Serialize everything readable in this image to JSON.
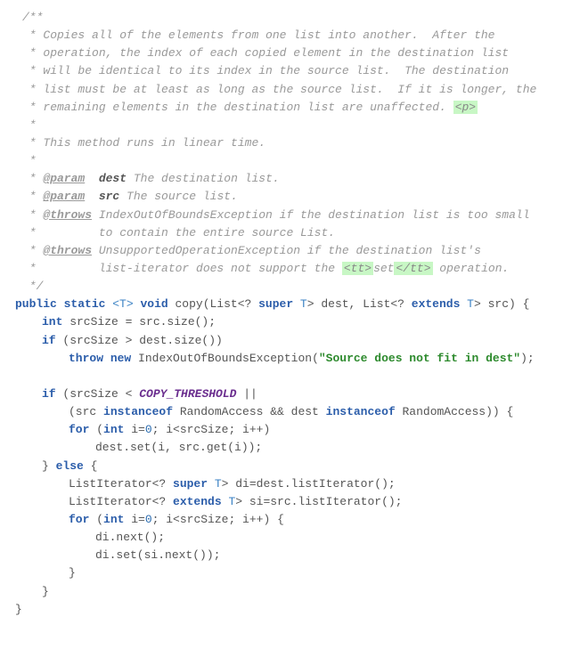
{
  "doc": {
    "open": "/**",
    "l1": " * Copies all of the elements from one list into another.  After the",
    "l2": " * operation, the index of each copied element in the destination list",
    "l3": " * will be identical to its index in the source list.  The destination",
    "l4": " * list must be at least as long as the source list.  If it is longer, the",
    "l5a": " * remaining elements in the destination list are unaffected. ",
    "l5h": "<p>",
    "l6": " *",
    "l7": " * This method runs in linear time.",
    "l8": " *",
    "l9a": " * ",
    "l9tag": "@param",
    "l9b": "  ",
    "l9p": "dest",
    "l9c": " The destination list.",
    "l10a": " * ",
    "l10tag": "@param",
    "l10b": "  ",
    "l10p": "src",
    "l10c": " The source list.",
    "l11a": " * ",
    "l11tag": "@throws",
    "l11b": " IndexOutOfBoundsException if the destination list is too small",
    "l12": " *         to contain the entire source List.",
    "l13a": " * ",
    "l13tag": "@throws",
    "l13b": " UnsupportedOperationException if the destination list's",
    "l14a": " *         list-iterator does not support the ",
    "l14h1": "<tt>",
    "l14b": "set",
    "l14h2": "</tt>",
    "l14c": " operation.",
    "close": " */"
  },
  "code": {
    "sig_public": "public",
    "sig_static": "static",
    "sig_tparam": "<T>",
    "sig_void": "void",
    "sig_copy": " copy(List<? ",
    "sig_super": "super",
    "sig_t1": " T",
    "sig_dest": "> dest, List<? ",
    "sig_extends": "extends",
    "sig_t2": " T",
    "sig_src": "> src) {",
    "l2_int": "int",
    "l2_rest": " srcSize = src.size();",
    "l3_if": "if",
    "l3_rest": " (srcSize > dest.size())",
    "l4_throw": "throw",
    "l4_new": "new",
    "l4_ex": " IndexOutOfBoundsException(",
    "l4_str": "\"Source does not fit in dest\"",
    "l4_end": ");",
    "l6_if": "if",
    "l6_a": " (srcSize < ",
    "l6_const": "COPY_THRESHOLD",
    "l6_b": " ||",
    "l7_a": "(src ",
    "l7_io1": "instanceof",
    "l7_b": " RandomAccess && dest ",
    "l7_io2": "instanceof",
    "l7_c": " RandomAccess)) {",
    "l8_for": "for",
    "l8_a": " (",
    "l8_int": "int",
    "l8_b": " i=",
    "l8_zero": "0",
    "l8_c": "; i<srcSize; i++)",
    "l9": "dest.set(i, src.get(i));",
    "l10_a": "} ",
    "l10_else": "else",
    "l10_b": " {",
    "l11_a": "ListIterator<? ",
    "l11_super": "super",
    "l11_b": " T",
    "l11_c": "> di=dest.listIterator();",
    "l12_a": "ListIterator<? ",
    "l12_ext": "extends",
    "l12_b": " T",
    "l12_c": "> si=src.listIterator();",
    "l13_for": "for",
    "l13_a": " (",
    "l13_int": "int",
    "l13_b": " i=",
    "l13_zero": "0",
    "l13_c": "; i<srcSize; i++) {",
    "l14": "di.next();",
    "l15": "di.set(si.next());",
    "l16": "}",
    "l17": "}",
    "l18": "}"
  }
}
